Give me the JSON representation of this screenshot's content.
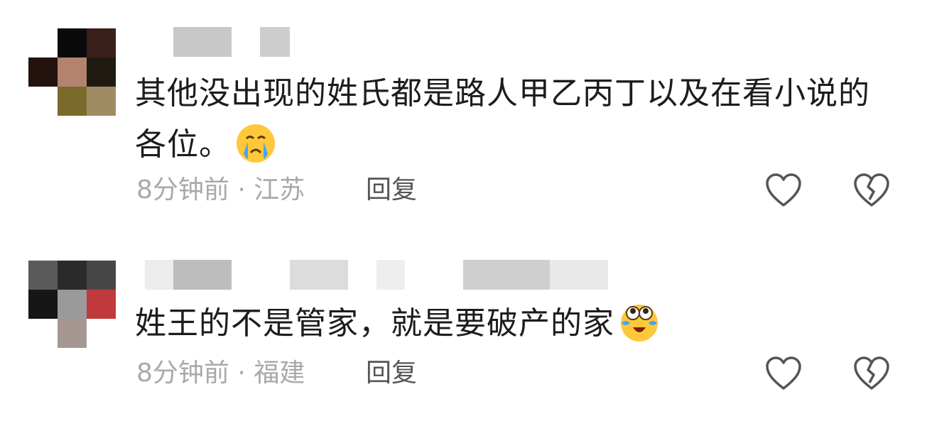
{
  "comments": [
    {
      "text": "其他没出现的姓氏都是路人甲乙丙丁以及在看小说的各位。",
      "emoji": "crying-face-emoji",
      "time": "8分钟前",
      "location": "江苏",
      "reply_label": "回复",
      "like_icon": "heart-outline-icon",
      "dislike_icon": "broken-heart-icon"
    },
    {
      "text": "姓王的不是管家，就是要破产的家",
      "emoji": "pleading-crying-emoji",
      "time": "8分钟前",
      "location": "福建",
      "reply_label": "回复",
      "like_icon": "heart-outline-icon",
      "dislike_icon": "broken-heart-icon"
    }
  ],
  "colors": {
    "meta_text": "#a9a9a9",
    "reply_text": "#555555",
    "icon_stroke": "#555555"
  }
}
